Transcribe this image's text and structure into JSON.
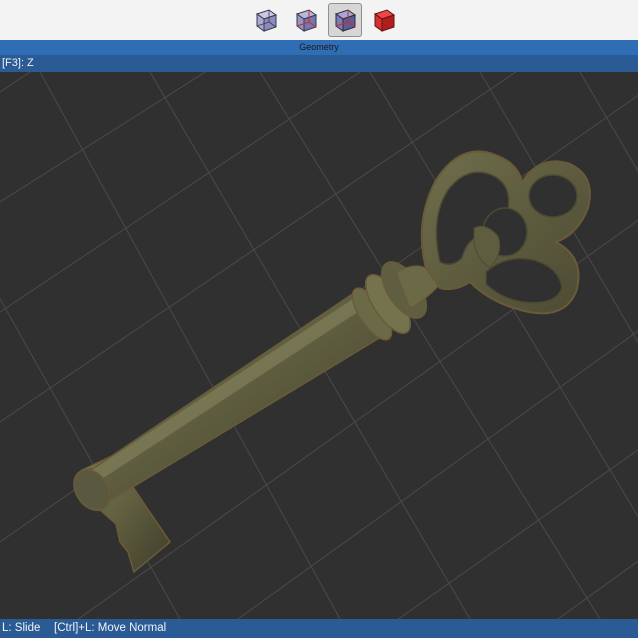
{
  "toolbar": {
    "buttons": [
      {
        "name": "wireframe-cube-button",
        "icon": "wireframe-cube-icon",
        "active": false
      },
      {
        "name": "shaded-wire-cube-button",
        "icon": "shaded-wire-cube-icon",
        "active": false
      },
      {
        "name": "shaded-cube-button",
        "icon": "shaded-cube-icon",
        "active": true
      },
      {
        "name": "solid-red-cube-button",
        "icon": "solid-red-cube-icon",
        "active": false
      }
    ]
  },
  "panel": {
    "title": "Geometry"
  },
  "viewport": {
    "label": "[F3]: Z",
    "model": "key-model",
    "colors": {
      "background": "#303030",
      "grid": "#4a4a4a",
      "key_base": "#5e5d3f",
      "key_highlight": "#7b7a55",
      "key_shadow": "#3f3d29",
      "key_rim": "#6a5a3a"
    }
  },
  "status": {
    "hint1": "L: Slide",
    "hint2": "[Ctrl]+L: Move Normal"
  },
  "colors": {
    "accent": "#2b5b94",
    "title_bar": "#2f6db5",
    "active_red": "#cc2a2a"
  }
}
